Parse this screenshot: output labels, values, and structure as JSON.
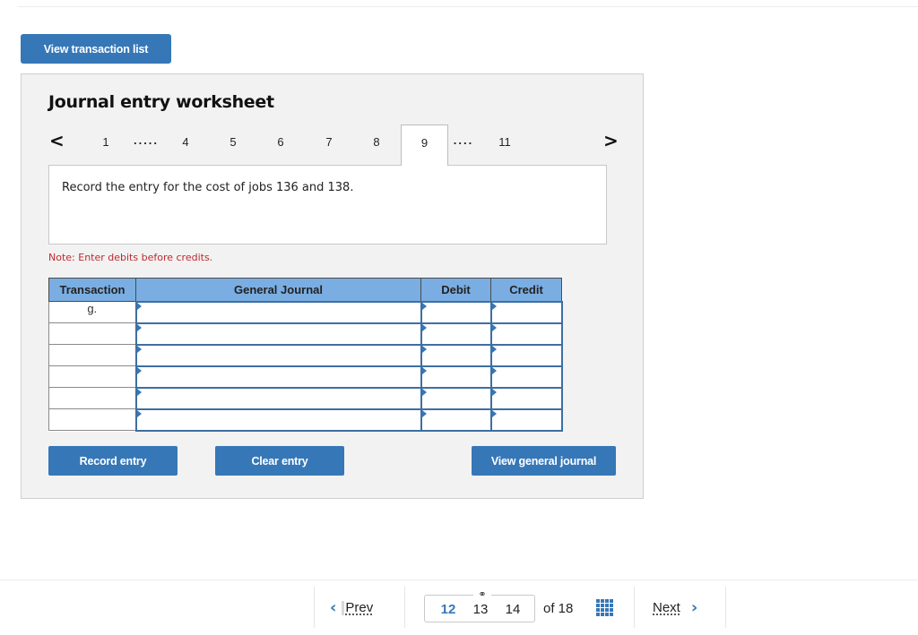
{
  "header": {
    "view_transaction_list_label": "View transaction list"
  },
  "worksheet": {
    "title": "Journal entry worksheet",
    "pager": {
      "prev_icon": "chevron-left-icon",
      "next_icon": "chevron-right-icon",
      "items": [
        {
          "label": "1"
        },
        {
          "label": "....."
        },
        {
          "label": "4"
        },
        {
          "label": "5"
        },
        {
          "label": "6"
        },
        {
          "label": "7"
        },
        {
          "label": "8"
        },
        {
          "label": "9",
          "active": true
        },
        {
          "label": "...."
        },
        {
          "label": "11"
        }
      ],
      "active": "9"
    },
    "prompt": "Record the entry for the cost of jobs 136 and 138.",
    "note": "Note: Enter debits before credits.",
    "table": {
      "headers": [
        "Transaction",
        "General Journal",
        "Debit",
        "Credit"
      ],
      "rows": [
        {
          "transaction": "g.",
          "account": "",
          "debit": "",
          "credit": ""
        },
        {
          "transaction": "",
          "account": "",
          "debit": "",
          "credit": ""
        },
        {
          "transaction": "",
          "account": "",
          "debit": "",
          "credit": ""
        },
        {
          "transaction": "",
          "account": "",
          "debit": "",
          "credit": ""
        },
        {
          "transaction": "",
          "account": "",
          "debit": "",
          "credit": ""
        },
        {
          "transaction": "",
          "account": "",
          "debit": "",
          "credit": ""
        }
      ]
    },
    "buttons": {
      "record_entry": "Record entry",
      "clear_entry": "Clear entry",
      "view_general_journal": "View general journal"
    }
  },
  "footer": {
    "prev_label": "Prev",
    "next_label": "Next",
    "pages": [
      "12",
      "13",
      "14"
    ],
    "current_page": "12",
    "of_total": "of 18",
    "link_icon": "link-icon",
    "grid_icon": "grid-icon"
  },
  "colors": {
    "accent": "#3677b7",
    "table_header": "#7aaee3",
    "note_red": "#c0282d",
    "panel_bg": "#f2f2f2"
  }
}
